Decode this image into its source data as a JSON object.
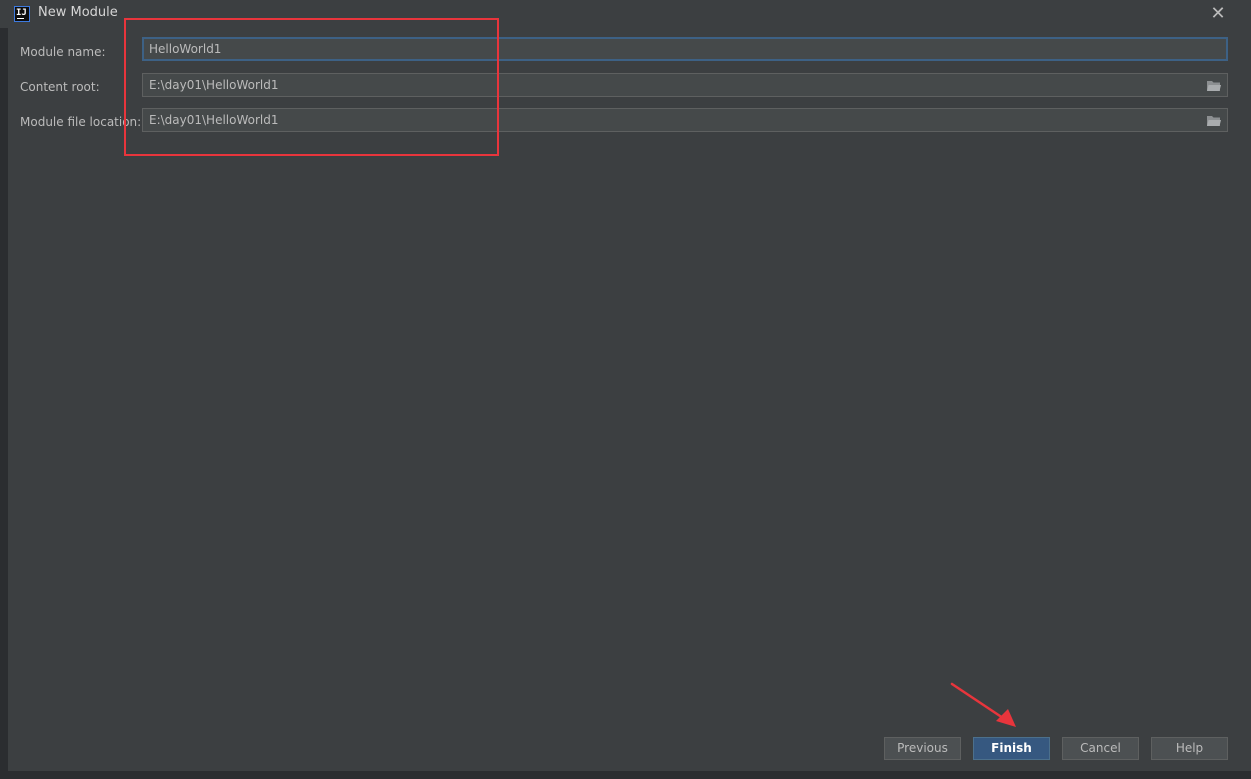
{
  "window": {
    "title": "New Module"
  },
  "form": {
    "module_name": {
      "label": "Module name:",
      "value": "HelloWorld1"
    },
    "content_root": {
      "label": "Content root:",
      "value": "E:\\day01\\HelloWorld1"
    },
    "module_file_location": {
      "label": "Module file location:",
      "value": "E:\\day01\\HelloWorld1"
    }
  },
  "buttons": {
    "previous": "Previous",
    "finish": "Finish",
    "cancel": "Cancel",
    "help": "Help"
  },
  "icons": {
    "app": "intellij-app-icon",
    "close": "close-icon",
    "folder": "folder-open-icon"
  },
  "colors": {
    "annotation": "#e8353c",
    "primary_button": "#365880",
    "focus_border": "#3d6185"
  }
}
